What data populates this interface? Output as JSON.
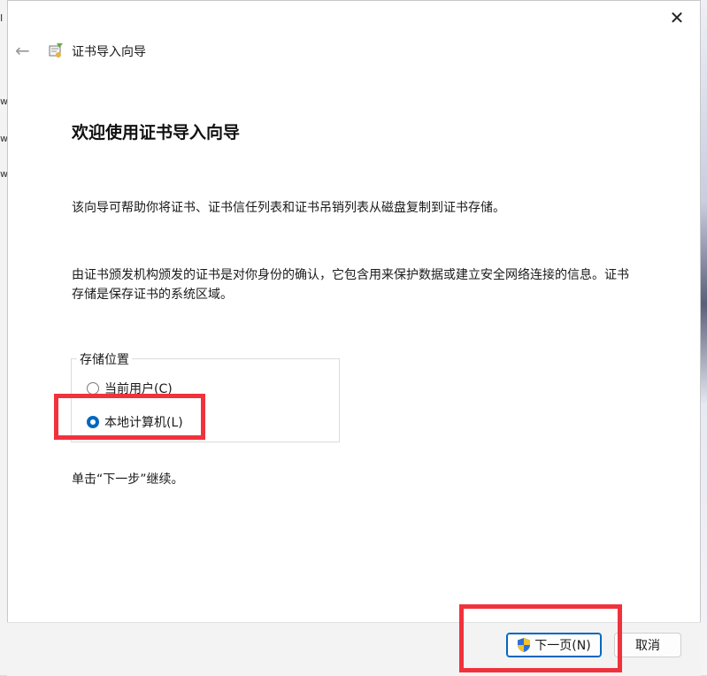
{
  "background": {
    "left_items": [
      "I",
      "w",
      "w",
      "w"
    ]
  },
  "window": {
    "title": "证书导入向导",
    "close_glyph": "✕",
    "back_glyph": "←"
  },
  "content": {
    "heading": "欢迎使用证书导入向导",
    "paragraph1": "该向导可帮助你将证书、证书信任列表和证书吊销列表从磁盘复制到证书存储。",
    "paragraph2": "由证书颁发机构颁发的证书是对你身份的确认，它包含用来保护数据或建立安全网络连接的信息。证书存储是保存证书的系统区域。",
    "store_group": {
      "legend": "存储位置",
      "options": [
        {
          "label": "当前用户(C)",
          "selected": false
        },
        {
          "label": "本地计算机(L)",
          "selected": true
        }
      ]
    },
    "continue_text": "单击“下一步”继续。"
  },
  "footer": {
    "next_label": "下一页(N)",
    "cancel_label": "取消"
  },
  "colors": {
    "accent": "#0067c0",
    "highlight": "#f0323c"
  }
}
